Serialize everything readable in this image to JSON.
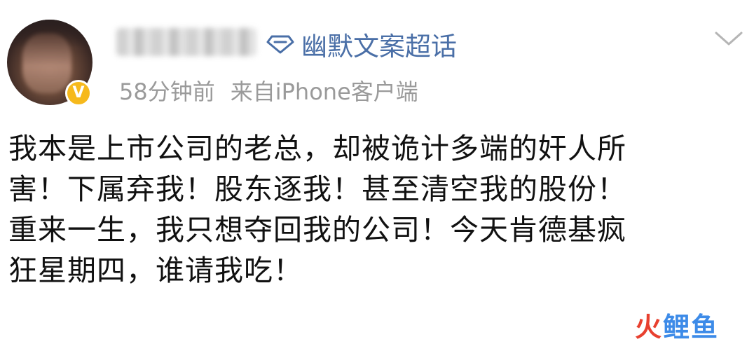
{
  "post": {
    "topic": "幽默文案超话",
    "time": "58分钟前",
    "source": "来自iPhone客户端",
    "verified_badge": "V",
    "content_lines": [
      "我本是上市公司的老总，却被诡计多端的奸人所",
      "害！下属弃我！股东逐我！甚至清空我的股份！",
      "重来一生，我只想夺回我的公司！今天肯德基疯",
      "狂星期四，谁请我吃！"
    ]
  },
  "watermark": {
    "part1": "火",
    "part2": "鲤鱼"
  },
  "icons": {
    "topic": "diamond-icon",
    "menu": "chevron-down-icon"
  }
}
